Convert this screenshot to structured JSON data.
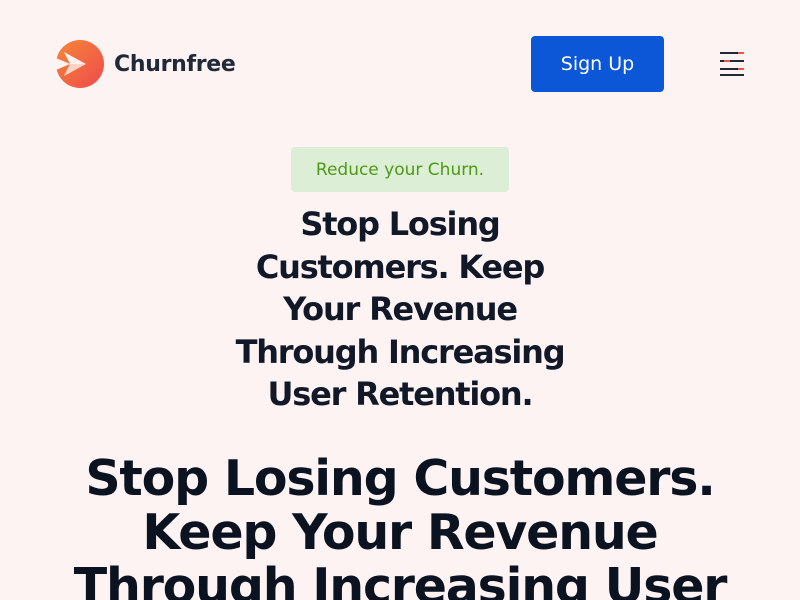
{
  "brand": {
    "name": "Churnfree",
    "logo_colors": {
      "red": "#f0534a",
      "orange": "#f5873a",
      "white": "#ffffff"
    }
  },
  "header": {
    "signup_label": "Sign Up",
    "menu_icon": "menu-lines-icon"
  },
  "hero": {
    "badge": "Reduce your Churn.",
    "headline_small": "Stop Losing Customers. Keep Your Revenue Through Increasing User Retention.",
    "headline_large": "Stop Losing Customers. Keep Your Revenue Through Increasing User"
  },
  "colors": {
    "background": "#fdf3f3",
    "primary": "#0b57d8",
    "badge_bg": "#dcefd6",
    "badge_text": "#4d9a15",
    "heading": "#111827",
    "menu_accent": "#f0534a"
  }
}
